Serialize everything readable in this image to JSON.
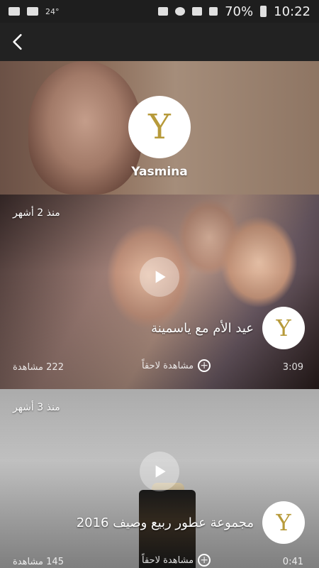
{
  "status_bar": {
    "temperature": "24°",
    "battery": "70%",
    "time": "10:22"
  },
  "app_bar": {
    "back_icon": "arrow-left-icon"
  },
  "profile": {
    "name": "Yasmina",
    "avatar_letter": "Y"
  },
  "videos": [
    {
      "time_ago": "منذ 2 أشهر",
      "title": "عيد الأم مع ياسمينة",
      "views": "222 مشاهدة",
      "watch_later": "مشاهدة لاحقاً",
      "duration": "3:09",
      "avatar_letter": "Y"
    },
    {
      "time_ago": "منذ 3 أشهر",
      "title": "مجموعة عطور ربيع وصيف 2016",
      "views": "145 مشاهدة",
      "watch_later": "مشاهدة لاحقاً",
      "duration": "0:41",
      "avatar_letter": "Y"
    }
  ],
  "colors": {
    "brand_gold": "#b79a3a",
    "app_bar_bg": "#222222"
  }
}
